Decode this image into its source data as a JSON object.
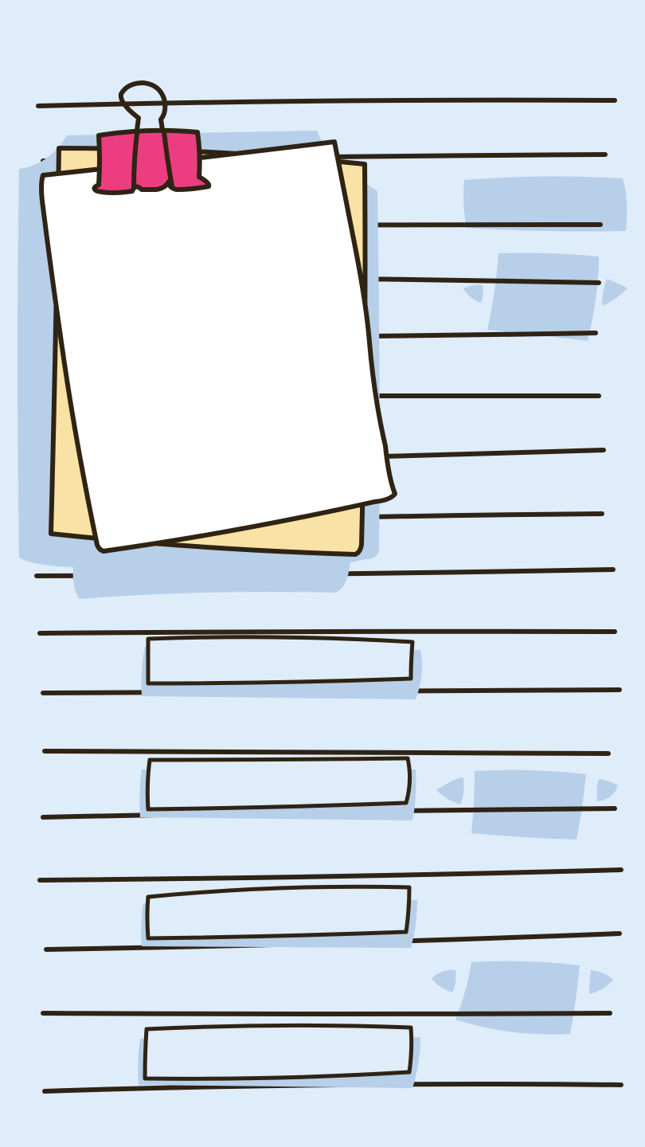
{
  "theme": {
    "background": "#dfecfa",
    "shadow": "#b7cfe8",
    "ink": "#2f2314",
    "note_back": "#f9e2a5",
    "note_front": "#ffffff",
    "clip": "#ec3d80"
  },
  "scene": {
    "ruled_lines": 19,
    "empty_bars": 4,
    "note_pages": 2,
    "binder_clip": "binder-clip-icon"
  }
}
